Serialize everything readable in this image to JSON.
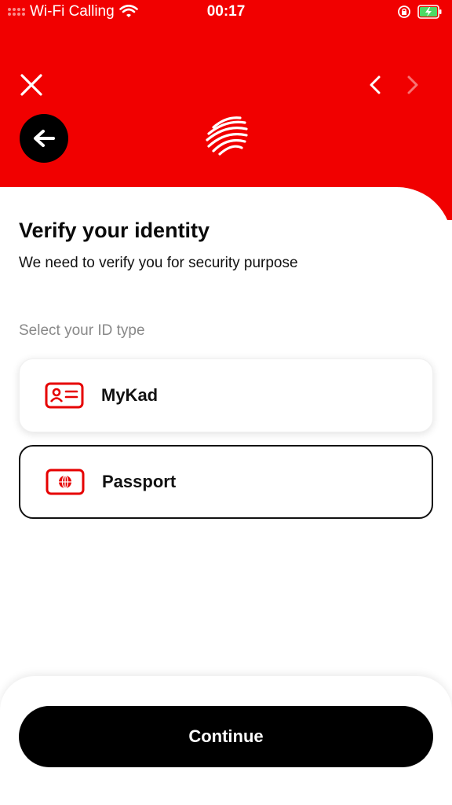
{
  "status_bar": {
    "carrier": "Wi-Fi Calling",
    "time": "00:17",
    "icons": [
      "signal-dots-icon",
      "wifi-icon",
      "orientation-lock-icon",
      "battery-charging-icon"
    ]
  },
  "header": {
    "background": "#f10000",
    "close_icon": "close-icon",
    "prev_icon": "chevron-left-icon",
    "next_icon": "chevron-right-icon",
    "back_icon": "arrow-left-icon",
    "logo_icon": "brand-swirl-logo"
  },
  "page": {
    "title": "Verify your identity",
    "subtitle": "We need to verify you for security purpose",
    "section_label": "Select your ID type",
    "options": [
      {
        "label": "MyKad",
        "icon": "id-card-icon",
        "selected": false
      },
      {
        "label": "Passport",
        "icon": "passport-icon",
        "selected": true
      }
    ]
  },
  "footer": {
    "continue_label": "Continue"
  },
  "colors": {
    "accent": "#f10000",
    "primary_button": "#000000",
    "muted_text": "#888888"
  }
}
